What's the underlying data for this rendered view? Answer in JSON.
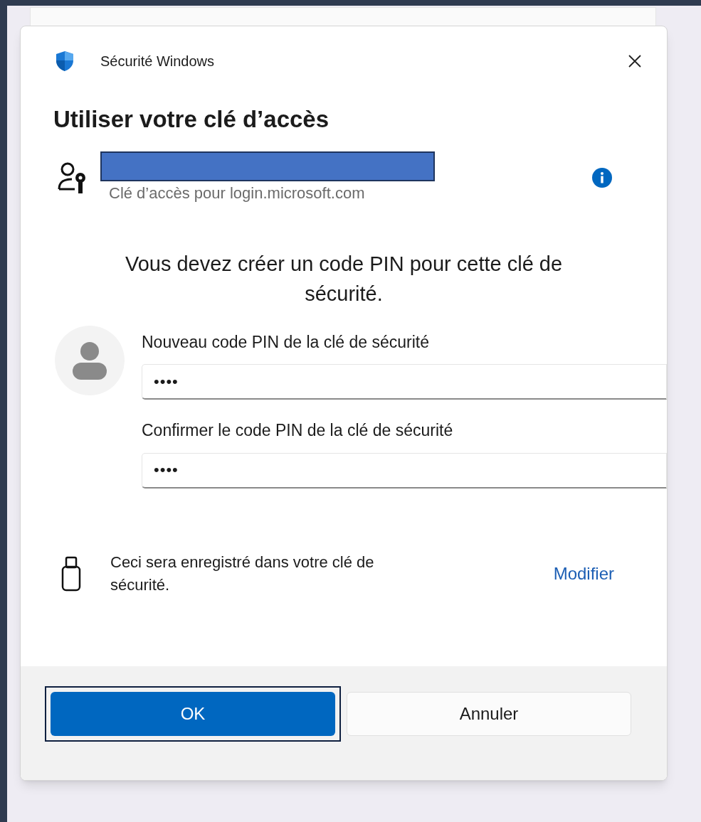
{
  "window": {
    "app_name": "Sécurité Windows"
  },
  "heading": "Utiliser votre clé d’accès",
  "account": {
    "subtitle": "Clé d’accès pour login.microsoft.com"
  },
  "message": "Vous devez créer un code PIN pour cette clé de sécurité.",
  "fields": [
    {
      "label": "Nouveau code PIN de la clé de sécurité",
      "value": "••••"
    },
    {
      "label": "Confirmer le code PIN de la clé de sécurité",
      "value": "••••"
    }
  ],
  "storage": {
    "text": "Ceci sera enregistré dans votre clé de sécurité.",
    "link": "Modifier"
  },
  "buttons": [
    {
      "label": "OK",
      "kind": "primary",
      "focused": true
    },
    {
      "label": "Annuler",
      "kind": "secondary",
      "focused": false
    }
  ]
}
